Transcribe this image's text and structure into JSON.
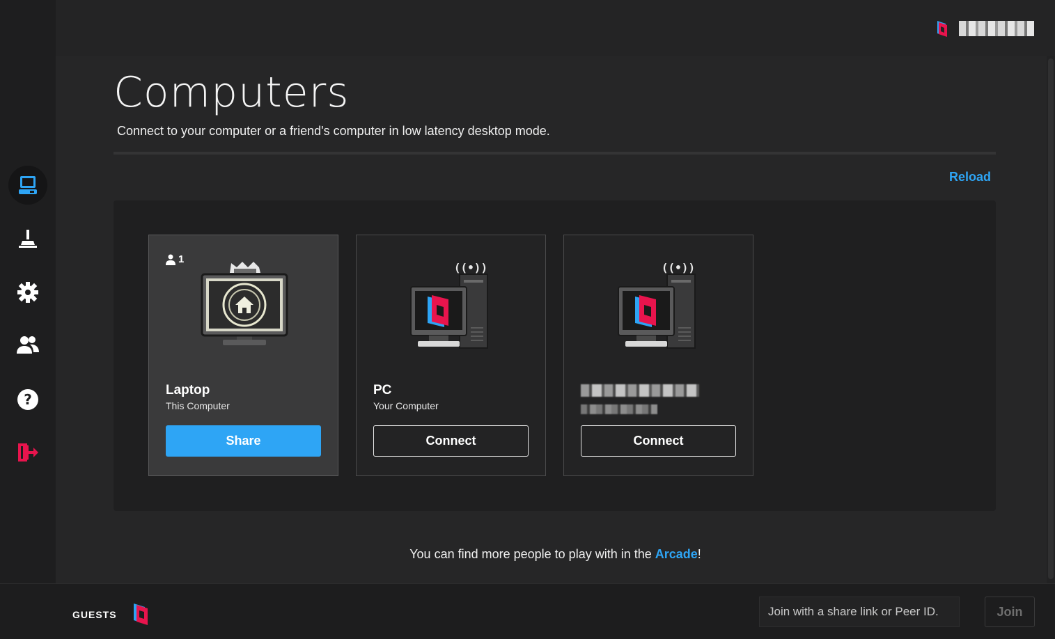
{
  "brand": {
    "accent": "#2ea5f5",
    "logo_red": "#e8144d",
    "logo_blue": "#2da4f5"
  },
  "account": {
    "logo_icon": "parsec-logo-icon"
  },
  "sidebar": {
    "items": [
      {
        "icon": "computer-icon",
        "active": true
      },
      {
        "icon": "joystick-icon"
      },
      {
        "icon": "gear-icon"
      },
      {
        "icon": "friends-icon"
      },
      {
        "icon": "help-icon"
      },
      {
        "icon": "logout-icon"
      }
    ]
  },
  "page": {
    "title": "Computers",
    "subtitle": "Connect to your computer or a friend's computer in low latency desktop mode.",
    "reload_label": "Reload"
  },
  "computers": [
    {
      "name": "Laptop",
      "description": "This Computer",
      "button": "Share",
      "guest_count": "1",
      "art": "home-monitor-icon"
    },
    {
      "name": "PC",
      "description": "Your Computer",
      "button": "Connect",
      "art": "pc-tower-icon"
    },
    {
      "name": "",
      "description": "",
      "button": "Connect",
      "art": "pc-tower-icon"
    }
  ],
  "footer_note": {
    "prefix": "You can find more people to play with in the ",
    "link": "Arcade",
    "suffix": "!"
  },
  "bottom": {
    "guests_label": "GUESTS",
    "join_placeholder": "Join with a share link or Peer ID.",
    "join_button": "Join"
  }
}
